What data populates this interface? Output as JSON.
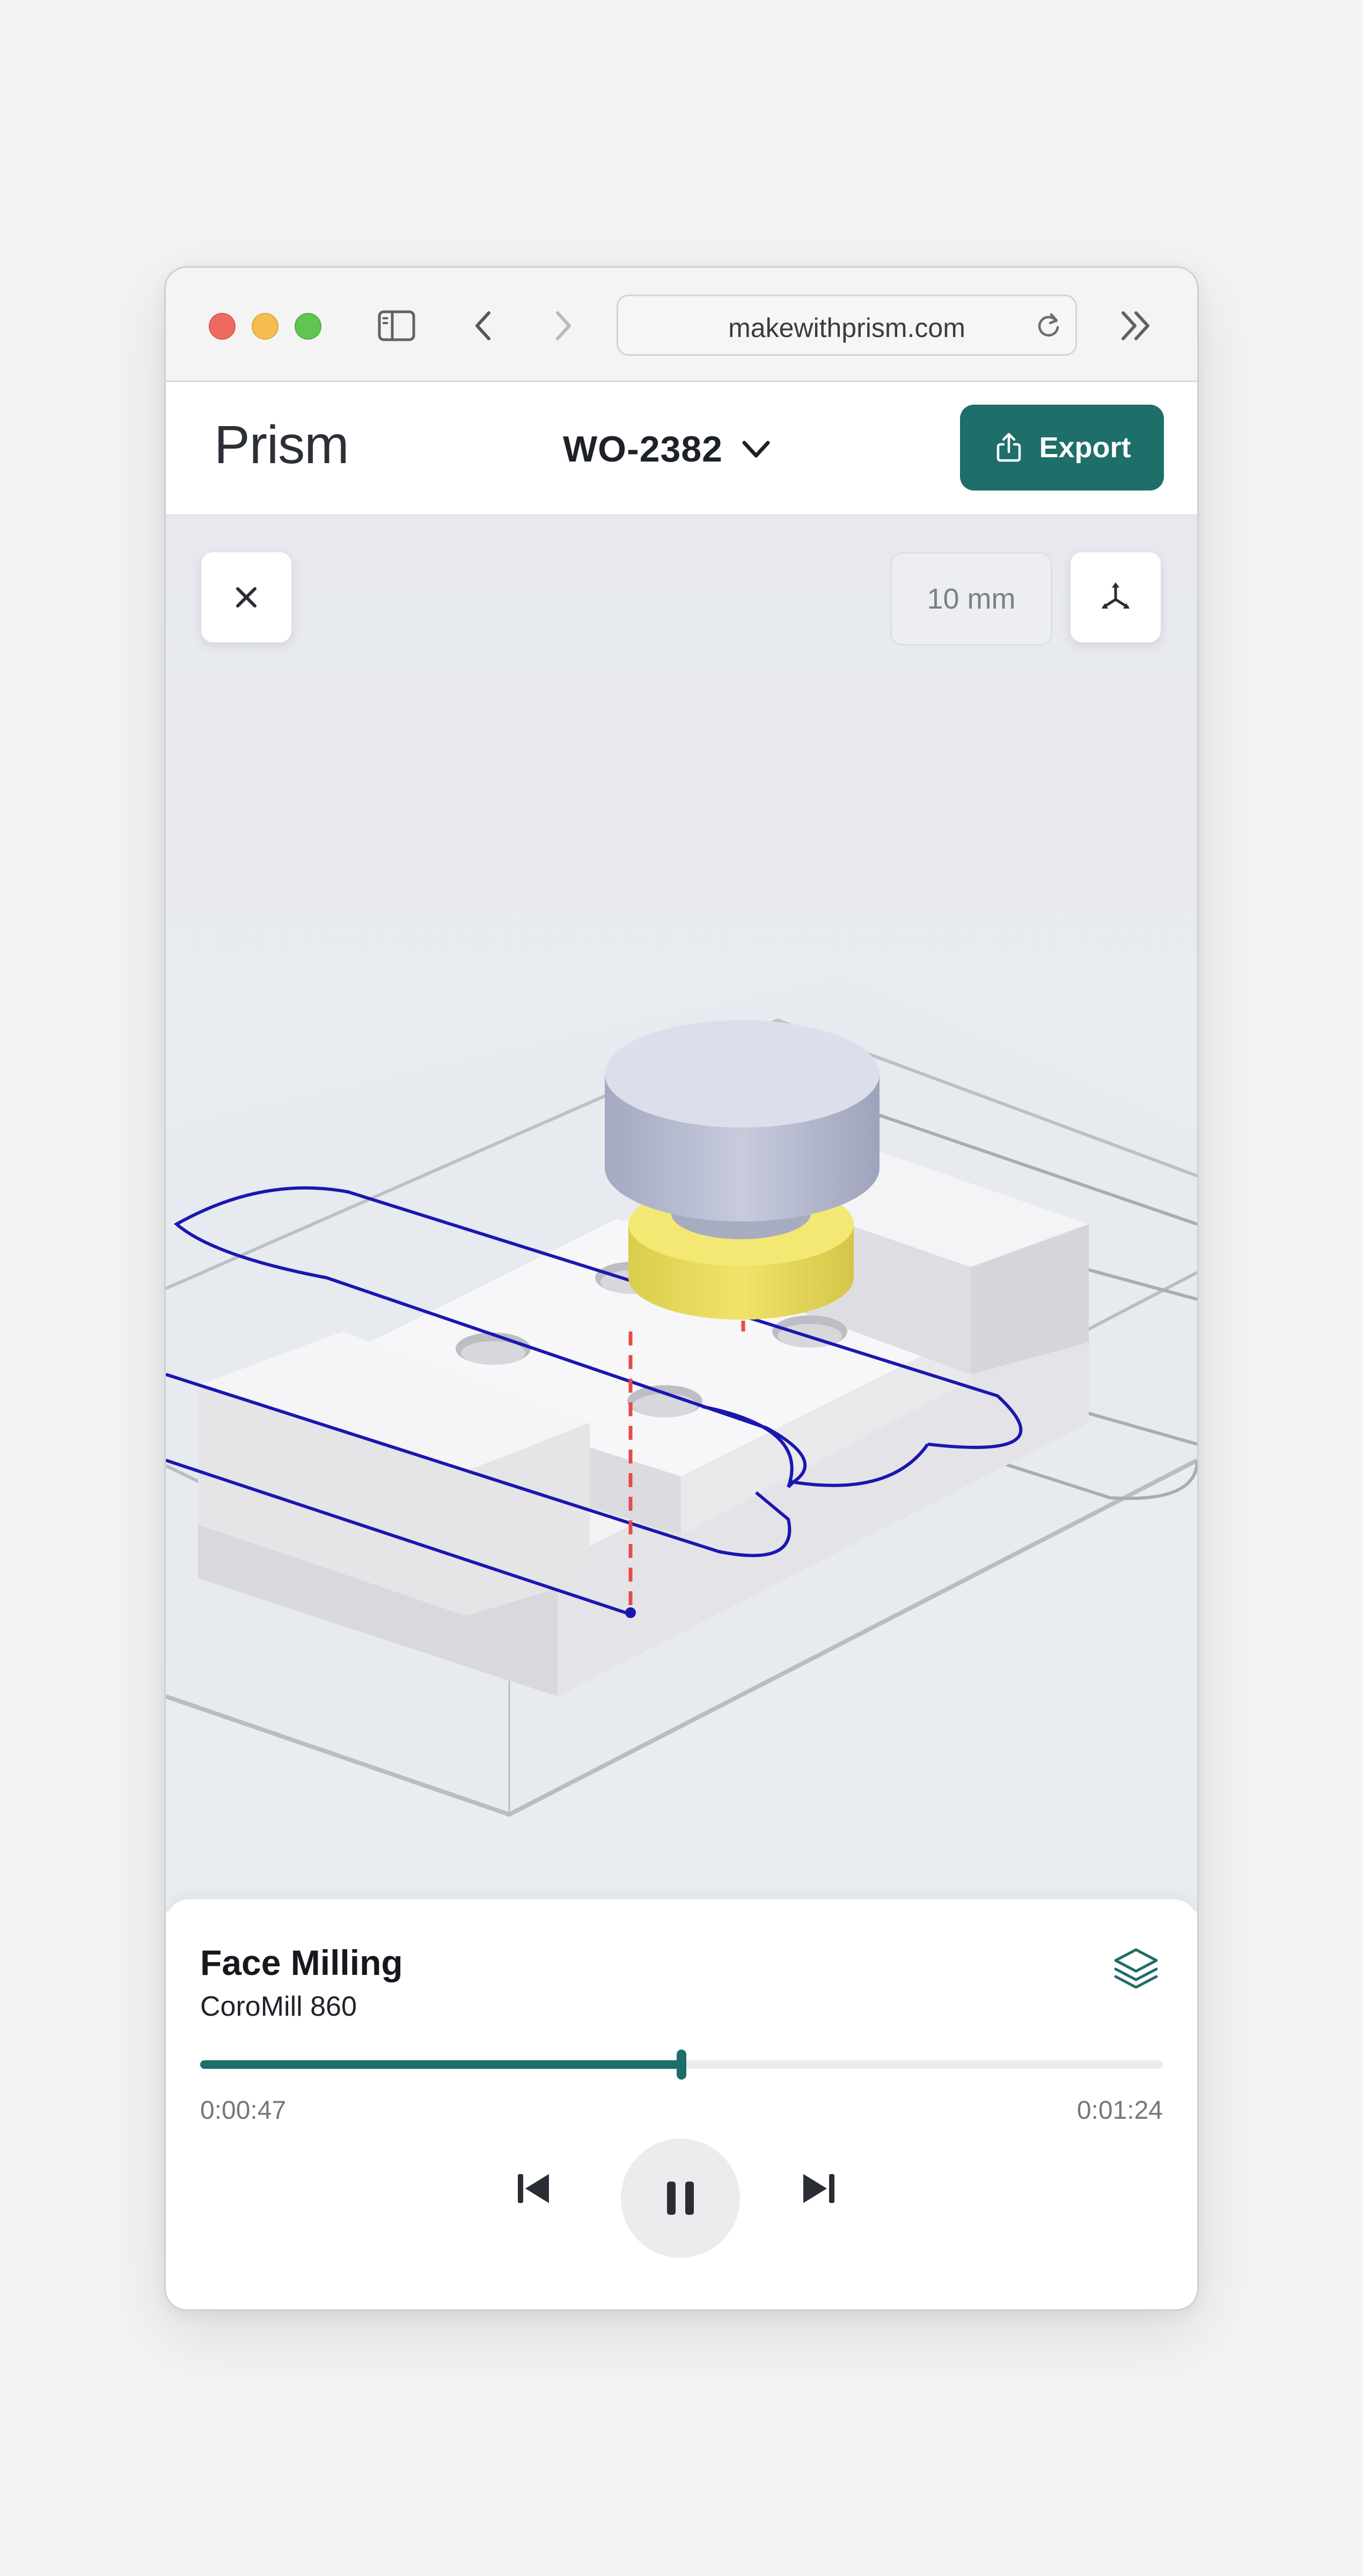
{
  "browser": {
    "url": "makewithprism.com",
    "icons": [
      "sidebar-icon",
      "back-icon",
      "forward-icon",
      "reload-icon",
      "extensions-icon"
    ]
  },
  "header": {
    "logo": "Prism",
    "work_order": "WO-2382",
    "export_label": "Export"
  },
  "viewport": {
    "scale_label": "10 mm",
    "icons": [
      "close-icon",
      "axes-icon"
    ]
  },
  "operation": {
    "title": "Face Milling",
    "tool": "CoroMill 860",
    "current_time": "0:00:47",
    "total_time": "0:01:24",
    "progress_fraction": 0.5
  },
  "colors": {
    "accent": "#1e6e6a",
    "toolpath": "#1a17b0",
    "plunge": "#e84a4a",
    "tool_holder": "#f0e46a"
  }
}
